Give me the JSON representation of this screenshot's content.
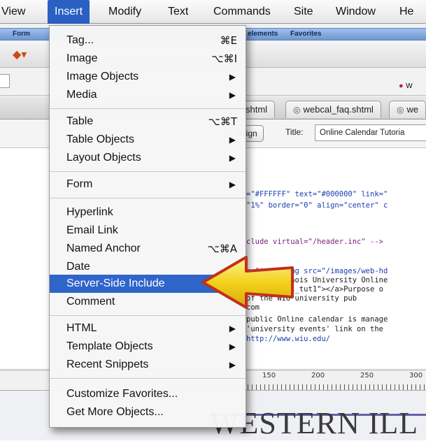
{
  "menubar": {
    "items": [
      "View",
      "Insert",
      "Modify",
      "Text",
      "Commands",
      "Site",
      "Window",
      "He"
    ],
    "active_index": 1
  },
  "insert_bar": {
    "items": [
      "Form",
      "elements",
      "Favorites"
    ]
  },
  "address_bar": {
    "tab_label": "w"
  },
  "document_tabs": [
    "shtml",
    "webcal_faq.shtml",
    "we"
  ],
  "view_toolbar": {
    "design_label": "esign",
    "title_label": "Title:",
    "title_value": "Online Calendar Tutoria"
  },
  "code_lines": [
    "=\"#FFFFFF\" text=\"#000000\" link=\"",
    "\"1%\" border=\"0\" align=\"center\" c",
    "clude virtual=\"/header.inc\" -->",
    "n=\"top\"><img src=\"/images/web-hd",
    "stern Illinois University Online",
    "name=\"focal_tut1\"></a>Purpose o",
    "of the WIU university pub",
    "com",
    "public Online calendar is manage",
    "'university events' link on the",
    "http://www.wiu.edu/"
  ],
  "ruler": {
    "ticks": [
      "150",
      "200",
      "250",
      "300"
    ]
  },
  "page_preview": {
    "heading": "WESTERN ILL"
  },
  "insert_menu": {
    "items": [
      {
        "label": "Tag...",
        "shortcut": "⌘E",
        "submenu": false
      },
      {
        "label": "Image",
        "shortcut": "⌥⌘I",
        "submenu": false
      },
      {
        "label": "Image Objects",
        "shortcut": "",
        "submenu": true
      },
      {
        "label": "Media",
        "shortcut": "",
        "submenu": true
      },
      {
        "label": "Table",
        "shortcut": "⌥⌘T",
        "submenu": false
      },
      {
        "label": "Table Objects",
        "shortcut": "",
        "submenu": true
      },
      {
        "label": "Layout Objects",
        "shortcut": "",
        "submenu": true
      },
      {
        "label": "Form",
        "shortcut": "",
        "submenu": true
      },
      {
        "label": "Hyperlink",
        "shortcut": "",
        "submenu": false
      },
      {
        "label": "Email Link",
        "shortcut": "",
        "submenu": false
      },
      {
        "label": "Named Anchor",
        "shortcut": "⌥⌘A",
        "submenu": false
      },
      {
        "label": "Date",
        "shortcut": "",
        "submenu": false
      },
      {
        "label": "Server-Side Include",
        "shortcut": "",
        "submenu": false,
        "highlighted": true
      },
      {
        "label": "Comment",
        "shortcut": "",
        "submenu": false
      },
      {
        "label": "HTML",
        "shortcut": "",
        "submenu": true
      },
      {
        "label": "Template Objects",
        "shortcut": "",
        "submenu": true
      },
      {
        "label": "Recent Snippets",
        "shortcut": "",
        "submenu": true
      },
      {
        "label": "Customize Favorites...",
        "shortcut": "",
        "submenu": false
      },
      {
        "label": "Get More Objects...",
        "shortcut": "",
        "submenu": false
      }
    ]
  },
  "colors": {
    "menu_highlight": "#2f64c9",
    "menubar_active": "#2a5fc4",
    "pointer_fill": "#f2d21b",
    "pointer_outline": "#c1301c"
  },
  "icons": [
    "submenu-arrow-icon",
    "file-icon",
    "insert-toolbar-icon",
    "pointer-arrow-icon"
  ]
}
